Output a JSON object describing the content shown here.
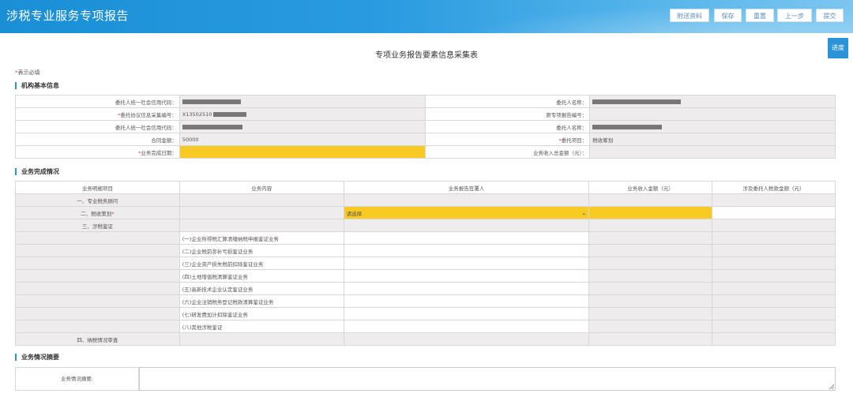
{
  "app": {
    "title": "涉税专业服务专项报告"
  },
  "toolbar": {
    "buttons": [
      "附送资料",
      "保存",
      "重置",
      "上一步",
      "提交"
    ]
  },
  "progress_label": "进度",
  "form_title": "专项业务报告要素信息采集表",
  "required_note": {
    "star": "*",
    "text": "表示必填"
  },
  "section1": {
    "title": "机构基本信息",
    "rows": [
      {
        "left_label": "委托人统一社会信用代码：",
        "left_required": false,
        "left_value": "",
        "right_label": "委托人名称：",
        "right_required": false,
        "right_value": ""
      },
      {
        "left_label": "委托协议信息采集编号：",
        "left_required": true,
        "left_value": "X13502510",
        "right_label": "原专项报告编号：",
        "right_required": false,
        "right_value": ""
      },
      {
        "left_label": "委托人统一社会信用代码：",
        "left_required": false,
        "left_value": "",
        "right_label": "委托人名称：",
        "right_required": false,
        "right_value": ""
      },
      {
        "left_label": "合同金额：",
        "left_required": false,
        "left_value": "50000",
        "right_label": "委托项目：",
        "right_required": true,
        "right_value": "税收筹划"
      },
      {
        "left_label": "业务完成日期：",
        "left_required": true,
        "left_value": "",
        "right_label": "业务收入总金额（元）：",
        "right_required": false,
        "right_value": ""
      }
    ]
  },
  "section2": {
    "title": "业务完成情况",
    "headers": [
      "业务明细项目",
      "业务内容",
      "业务报告签署人",
      "业务收入金额（元）",
      "涉及委托人税款金额（元）"
    ],
    "rows": [
      {
        "item": "一、专业税务顾问",
        "content": ""
      },
      {
        "item": "二、税收策划",
        "content": "",
        "required": true,
        "signer": "请选择"
      },
      {
        "item": "三、涉税鉴证",
        "content": ""
      },
      {
        "item": "",
        "content": "(一)企业所得税汇算清缴纳税申报鉴证业务"
      },
      {
        "item": "",
        "content": "(二)企业税前弥补亏损鉴证业务"
      },
      {
        "item": "",
        "content": "(三)企业资产损失税前扣除鉴证业务"
      },
      {
        "item": "",
        "content": "(四)土地增值税清算鉴证业务"
      },
      {
        "item": "",
        "content": "(五)高新技术企业认定鉴证业务"
      },
      {
        "item": "",
        "content": "(六)企业注销税务登记税款清算鉴证业务"
      },
      {
        "item": "",
        "content": "(七)研发费加计扣除鉴证业务"
      },
      {
        "item": "",
        "content": "(八)其他涉税鉴证"
      },
      {
        "item": "四、纳税情况审查",
        "content": ""
      }
    ]
  },
  "section3": {
    "title": "业务情况摘要",
    "label": "业务情况摘要:"
  }
}
